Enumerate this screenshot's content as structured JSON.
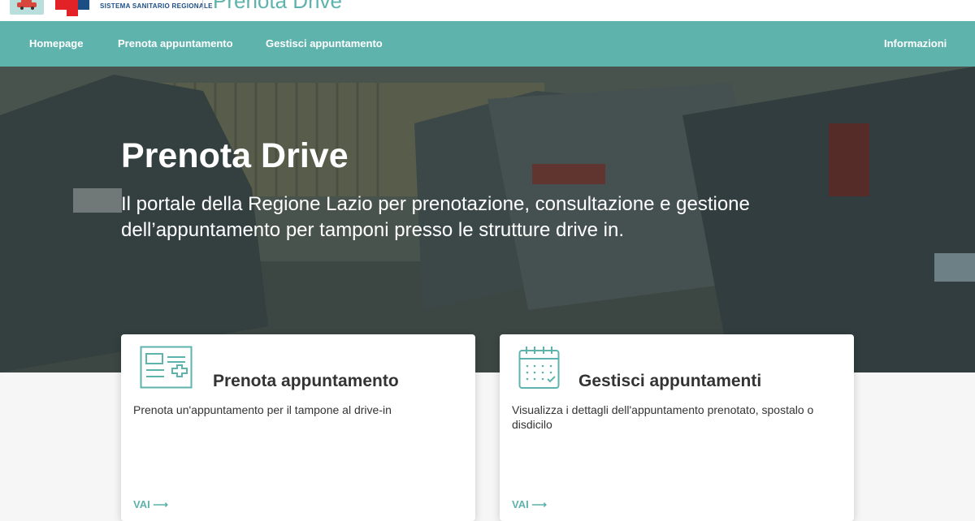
{
  "header": {
    "region_text": "SISTEMA SANITARIO REGIONALE",
    "title": "Prenota Drive"
  },
  "nav": {
    "items": [
      "Homepage",
      "Prenota appuntamento",
      "Gestisci appuntamento"
    ],
    "info": "Informazioni"
  },
  "hero": {
    "title": "Prenota Drive",
    "subtitle": "Il portale della Regione Lazio per prenotazione, consultazione e gestione dell’appuntamento per tamponi presso le strutture drive in."
  },
  "cards": [
    {
      "title": "Prenota appuntamento",
      "description": "Prenota un'appuntamento per il tampone al drive-in",
      "link": "VAI",
      "icon": "id-card-plus-icon"
    },
    {
      "title": "Gestisci appuntamenti",
      "description": "Visualizza i dettagli dell'appuntamento prenotato, spostalo o disdicilo",
      "link": "VAI",
      "icon": "calendar-check-icon"
    }
  ],
  "colors": {
    "accent": "#5fb3ad",
    "white": "#ffffff"
  }
}
